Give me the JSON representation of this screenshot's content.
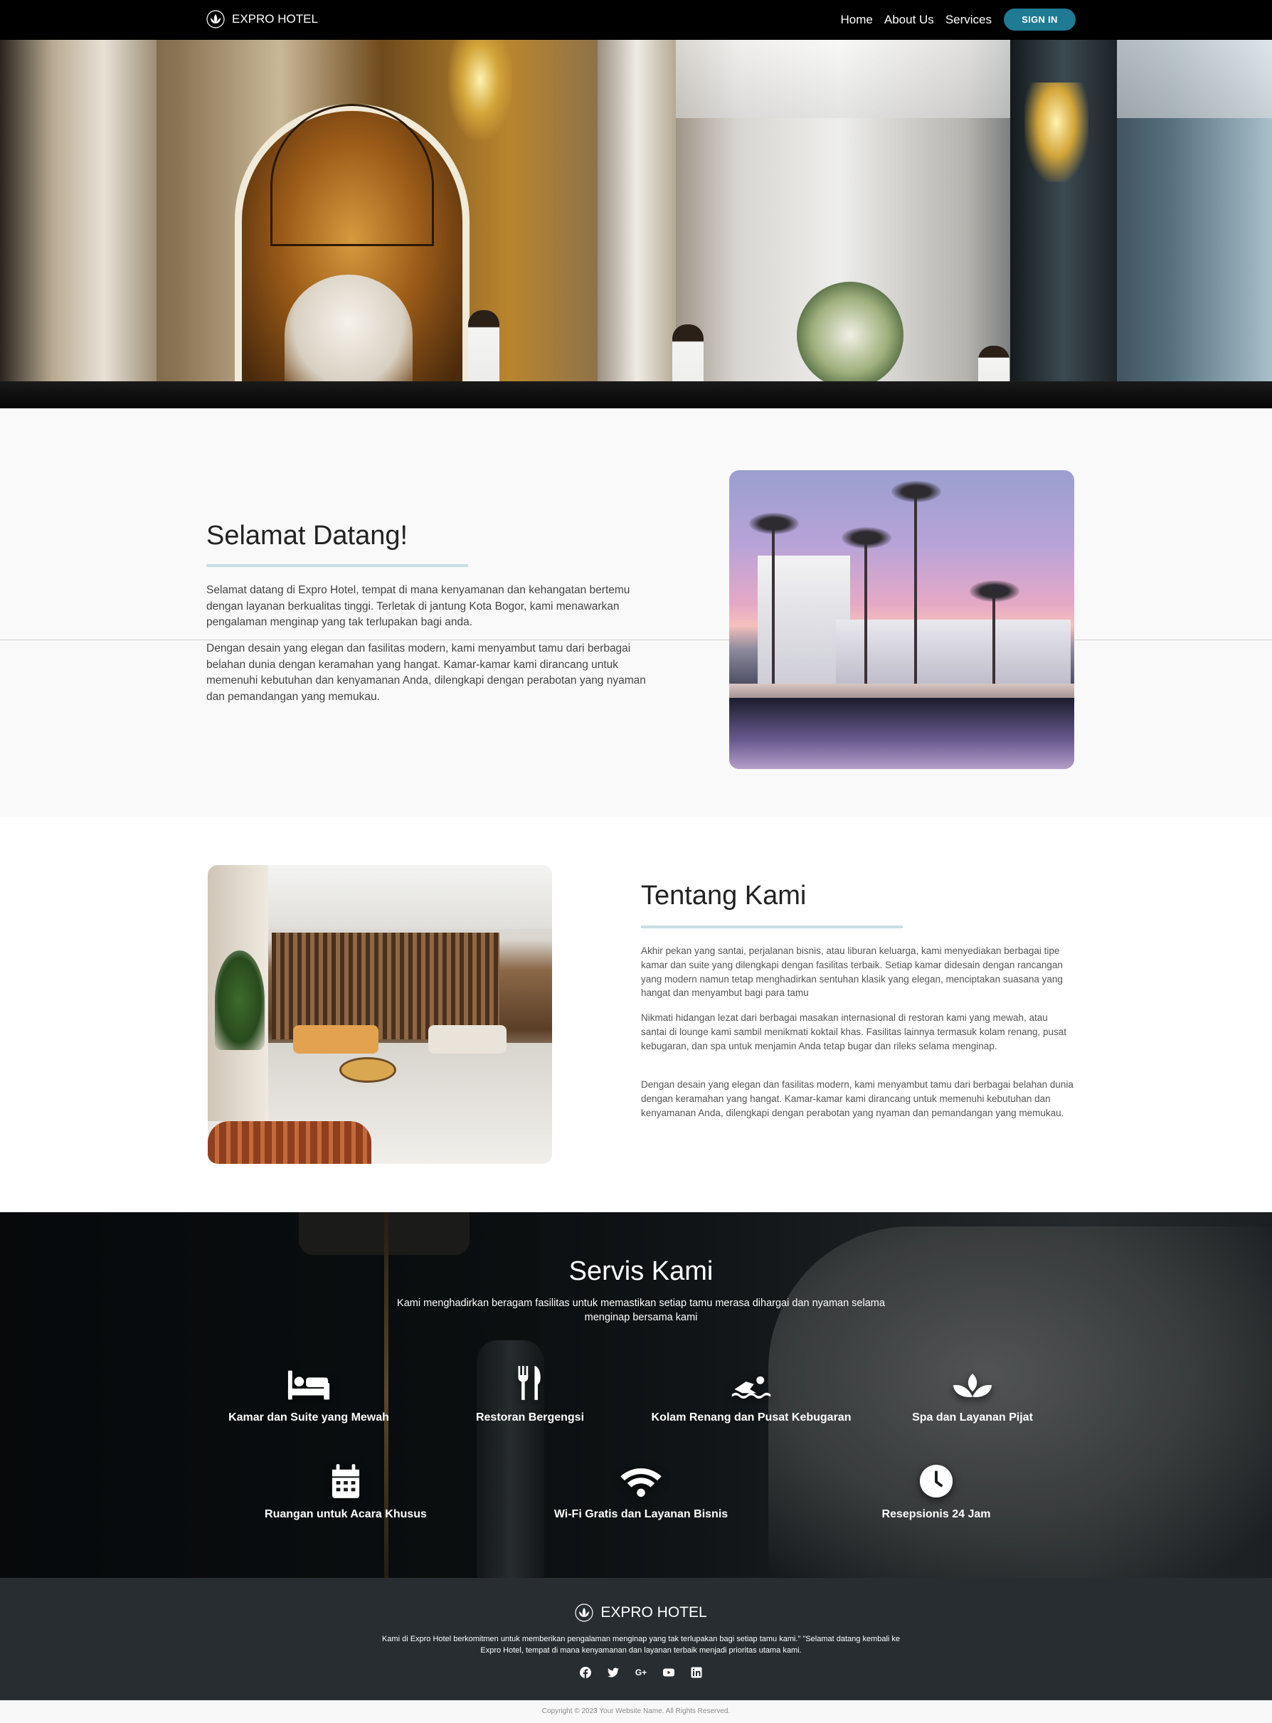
{
  "navbar": {
    "brand": "EXPRO HOTEL",
    "links": [
      "Home",
      "About Us",
      "Services"
    ],
    "signin": "SIGN IN",
    "signin_color": "#1f7a94"
  },
  "welcome": {
    "title": "Selamat Datang!",
    "paragraphs": [
      "Selamat datang di Expro Hotel, tempat di mana kenyamanan dan kehangatan bertemu dengan layanan berkualitas tinggi. Terletak di jantung Kota Bogor, kami menawarkan pengalaman menginap yang tak terlupakan bagi anda.",
      "Dengan desain yang elegan dan fasilitas modern, kami menyambut tamu dari berbagai belahan dunia dengan keramahan yang hangat. Kamar-kamar kami dirancang untuk memenuhi kebutuhan dan kenyamanan Anda, dilengkapi dengan perabotan yang nyaman dan pemandangan yang memukau."
    ]
  },
  "about": {
    "title": "Tentang Kami",
    "paragraphs": [
      "Akhir pekan yang santai, perjalanan bisnis, atau liburan keluarga, kami menyediakan berbagai tipe kamar dan suite yang dilengkapi dengan fasilitas terbaik. Setiap kamar didesain dengan rancangan yang modern namun tetap menghadirkan sentuhan klasik yang elegan, menciptakan suasana yang hangat dan menyambut bagi para tamu",
      "Nikmati hidangan lezat dari berbagai masakan internasional di restoran kami yang mewah, atau santai di lounge kami sambil menikmati koktail khas. Fasilitas lainnya termasuk kolam renang, pusat kebugaran, dan spa untuk menjamin Anda tetap bugar dan rileks selama menginap.",
      "Dengan desain yang elegan dan fasilitas modern, kami menyambut tamu dari berbagai belahan dunia dengan keramahan yang hangat. Kamar-kamar kami dirancang untuk memenuhi kebutuhan dan kenyamanan Anda, dilengkapi dengan perabotan yang nyaman dan pemandangan yang memukau."
    ]
  },
  "services": {
    "title": "Servis Kami",
    "subtitle": "Kami menghadirkan beragam fasilitas untuk memastikan setiap tamu merasa dihargai dan nyaman selama menginap bersama kami",
    "items": [
      {
        "label": "Kamar dan Suite yang Mewah",
        "icon": "bed-icon"
      },
      {
        "label": "Restoran Bergengsi",
        "icon": "utensils-icon"
      },
      {
        "label": "Kolam Renang dan Pusat Kebugaran",
        "icon": "swimmer-icon"
      },
      {
        "label": "Spa dan Layanan Pijat",
        "icon": "spa-icon"
      },
      {
        "label": "Ruangan untuk Acara Khusus",
        "icon": "calendar-icon"
      },
      {
        "label": "Wi-Fi Gratis dan Layanan Bisnis",
        "icon": "wifi-icon"
      },
      {
        "label": "Resepsionis 24 Jam",
        "icon": "clock-icon"
      }
    ]
  },
  "footer": {
    "brand": "EXPRO HOTEL",
    "text": "Kami di Expro Hotel berkomitmen untuk memberikan pengalaman menginap yang tak terlupakan bagi setiap tamu kami.\" \"Selamat datang kembali ke Expro Hotel, tempat di mana kenyamanan dan layanan terbaik menjadi prioritas utama kami.",
    "social": [
      "facebook-icon",
      "twitter-icon",
      "google-plus-icon",
      "youtube-icon",
      "linkedin-icon"
    ],
    "google_plus_label": "G+",
    "copyright": "Copyright © 2023 Your Website Name. All Rights Reserved."
  }
}
